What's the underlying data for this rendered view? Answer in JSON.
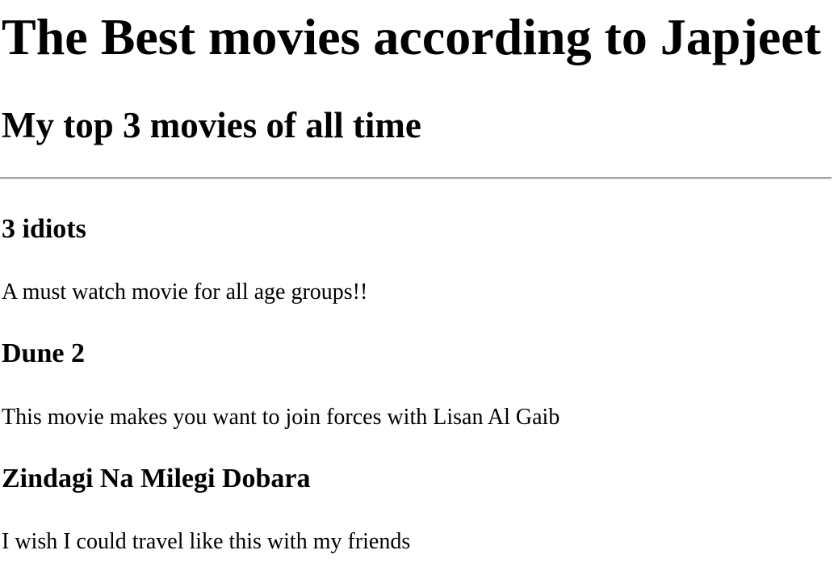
{
  "page": {
    "title": "The Best movies according to Japjeet",
    "subtitle": "My top 3 movies of all time"
  },
  "movies": [
    {
      "title": "3 idiots",
      "description": "A must watch movie for all age groups!!"
    },
    {
      "title": "Dune 2",
      "description": "This movie makes you want to join forces with Lisan Al Gaib"
    },
    {
      "title": "Zindagi Na Milegi Dobara",
      "description": "I wish I could travel like this with my friends"
    }
  ]
}
